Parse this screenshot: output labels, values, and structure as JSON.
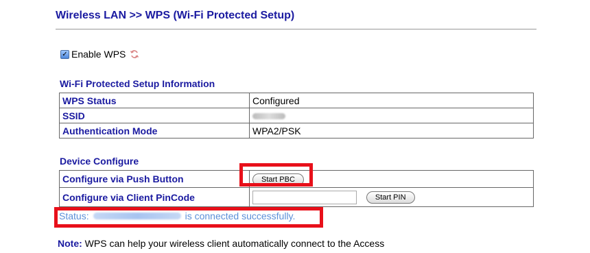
{
  "page": {
    "title": "Wireless LAN >> WPS (Wi-Fi Protected Setup)"
  },
  "enable": {
    "label": "Enable WPS",
    "checked": true
  },
  "info": {
    "heading": "Wi-Fi Protected Setup Information",
    "rows": [
      {
        "label": "WPS Status",
        "value": "Configured"
      },
      {
        "label": "SSID",
        "value": ""
      },
      {
        "label": "Authentication Mode",
        "value": "WPA2/PSK"
      }
    ]
  },
  "device": {
    "heading": "Device Configure",
    "push_label": "Configure via Push Button",
    "push_button": "Start PBC",
    "pin_label": "Configure via Client PinCode",
    "pin_value": "",
    "pin_button": "Start PIN"
  },
  "status": {
    "prefix": "Status:",
    "suffix": "is connected successfully."
  },
  "note": {
    "label": "Note:",
    "text": "WPS can help your wireless client automatically connect to the Access"
  },
  "colors": {
    "heading": "#1a1aa0",
    "status_text": "#5b8fd8",
    "highlight": "#e8101a"
  }
}
